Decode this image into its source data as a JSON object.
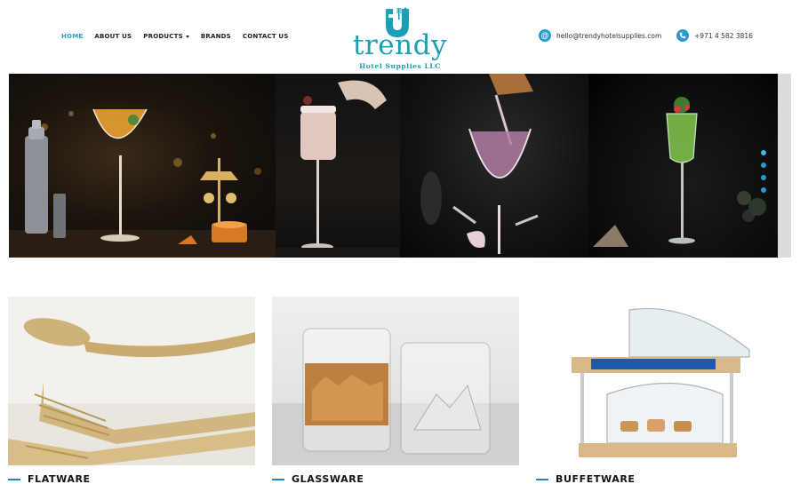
{
  "nav": {
    "items": [
      {
        "label": "HOME",
        "active": true
      },
      {
        "label": "ABOUT US"
      },
      {
        "label": "PRODUCTS",
        "dropdown": true
      },
      {
        "label": "BRANDS"
      },
      {
        "label": "CONTACT US"
      }
    ]
  },
  "logo": {
    "word": "trendy",
    "tagline": "Hotel Supplies LLC"
  },
  "contact": {
    "email": "hello@trendyhotelsupplies.com",
    "phone": "+971 4 582 3816",
    "email_icon": "at-icon",
    "phone_icon": "phone-icon"
  },
  "hero": {
    "slide_count": 4,
    "active_slide": 1
  },
  "categories": [
    {
      "label": "FLATWARE"
    },
    {
      "label": "GLASSWARE"
    },
    {
      "label": "BUFFETWARE"
    }
  ],
  "colors": {
    "accent": "#2a9bd0",
    "logo": "#1a9fb4",
    "label_bar": "#1e88c8"
  }
}
